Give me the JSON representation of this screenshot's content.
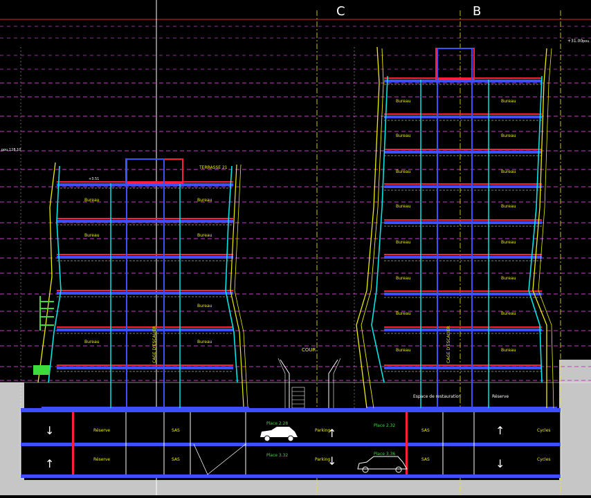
{
  "colors": {
    "background": "#000000",
    "ground": "#c6c6c6",
    "slab": "#ff1e3c",
    "blue": "#3c50ff",
    "cyan": "#00e6e6",
    "yellow": "#f0f000",
    "magenta": "#c83cc8",
    "green": "#3cdc3c",
    "white": "#ffffff",
    "grid": "#7a7a7a"
  },
  "grid_labels": {
    "c": "C",
    "b": "B"
  },
  "levels": {
    "top": "+31.00",
    "top_unit": "pou.",
    "left": "pou.128.10"
  },
  "left_building": {
    "terrace": "TERRASSE 21",
    "roof_label": "+3.51",
    "stair": "CAGE D'ESCALIER",
    "floor_labels": [
      {
        "left": "Bureau",
        "right": "Bureau"
      },
      {
        "left": "Bureau",
        "right": "Bureau"
      },
      {
        "left": "",
        "right": "Bureau"
      },
      {
        "left": "Bureau",
        "right": "Bureau"
      }
    ]
  },
  "right_building": {
    "stair": "CAGE D'ESCALIER",
    "floor_labels": [
      {
        "left": "Bureau",
        "right": "Bureau"
      },
      {
        "left": "Bureau",
        "right": "Bureau"
      },
      {
        "left": "Bureau",
        "right": "Bureau"
      },
      {
        "left": "Bureau",
        "right": "Bureau"
      },
      {
        "left": "Bureau",
        "right": "Bureau"
      },
      {
        "left": "Bureau",
        "right": "Bureau"
      },
      {
        "left": "Bureau",
        "right": "Bureau"
      },
      {
        "left": "Bureau",
        "right": "Bureau"
      }
    ],
    "ground_left": "Espace de restauration",
    "ground_right": "Réserve"
  },
  "court": "COUR",
  "basement": {
    "level1": {
      "reserve": "Réserve",
      "sas_left": "SAS",
      "place_a": "Place 2.28",
      "parking": "Parking",
      "place_b": "Place 2.32",
      "sas_right": "SAS",
      "cycles": "Cycles"
    },
    "level2": {
      "reserve": "Réserve",
      "sas_left": "SAS",
      "place_a": "Place 3.32",
      "parking": "Parking",
      "place_b": "Place 3.36",
      "sas_right": "SAS",
      "cycles": "Cycles"
    }
  }
}
